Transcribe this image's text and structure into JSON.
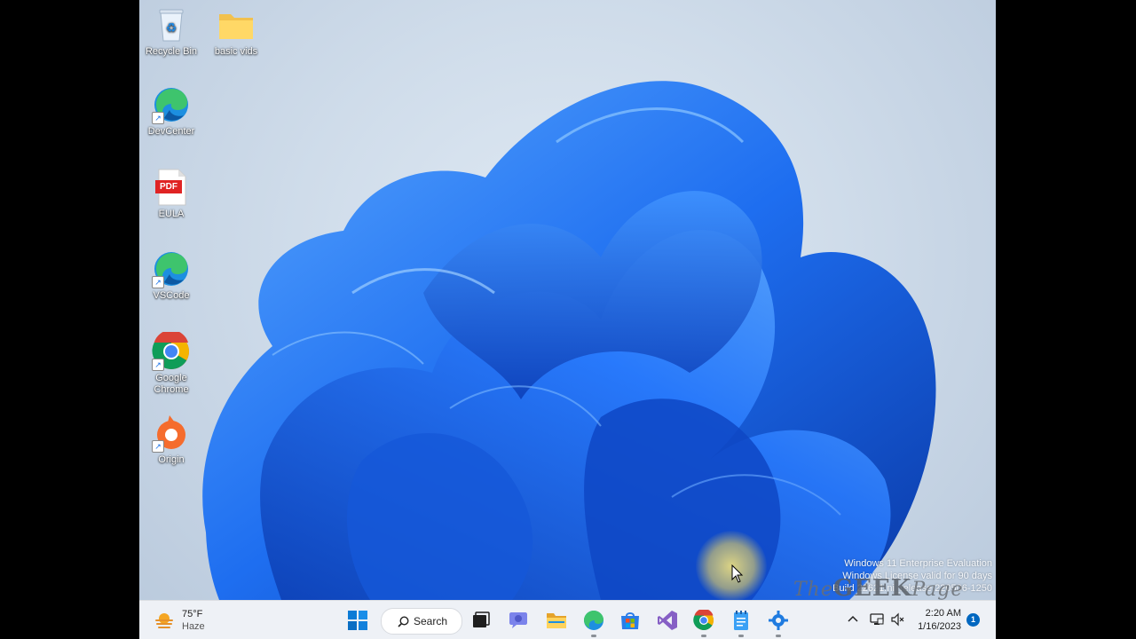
{
  "desktop": {
    "icons": [
      {
        "label": "Recycle Bin",
        "icon": "recycle-bin-icon"
      },
      {
        "label": "basic vids",
        "icon": "folder-icon"
      },
      {
        "label": "DevCenter",
        "icon": "edge-icon"
      },
      {
        "label": "EULA",
        "icon": "pdf-icon",
        "badge": "PDF"
      },
      {
        "label": "VSCode",
        "icon": "edge-icon"
      },
      {
        "label": "Google Chrome",
        "icon": "chrome-icon"
      },
      {
        "label": "Origin",
        "icon": "origin-icon"
      }
    ]
  },
  "watermark": {
    "line1": "Windows 11 Enterprise Evaluation",
    "line2": "Windows License valid for 90 days",
    "line3": "Build 22621.ni_release.220506-1250",
    "logo_the": "The",
    "logo_geek": "GEEK",
    "logo_page": "Page"
  },
  "taskbar": {
    "weather": {
      "temp": "75°F",
      "condition": "Haze"
    },
    "search_label": "Search",
    "apps": [
      {
        "name": "start",
        "icon": "windows-logo-icon"
      },
      {
        "name": "task-view",
        "icon": "task-view-icon"
      },
      {
        "name": "chat",
        "icon": "teams-chat-icon"
      },
      {
        "name": "file-explorer",
        "icon": "folder-icon"
      },
      {
        "name": "edge",
        "icon": "edge-icon"
      },
      {
        "name": "store",
        "icon": "store-icon"
      },
      {
        "name": "visual-studio",
        "icon": "visual-studio-icon"
      },
      {
        "name": "chrome",
        "icon": "chrome-icon"
      },
      {
        "name": "notepad",
        "icon": "notepad-icon"
      },
      {
        "name": "settings-app",
        "icon": "app-icon"
      }
    ],
    "clock": {
      "time": "2:20 AM",
      "date": "1/16/2023"
    },
    "notifications": "1"
  },
  "colors": {
    "accent": "#0067c0",
    "wallpaper_bloom": "#1a63e0",
    "taskbar": "#eef1f6"
  }
}
